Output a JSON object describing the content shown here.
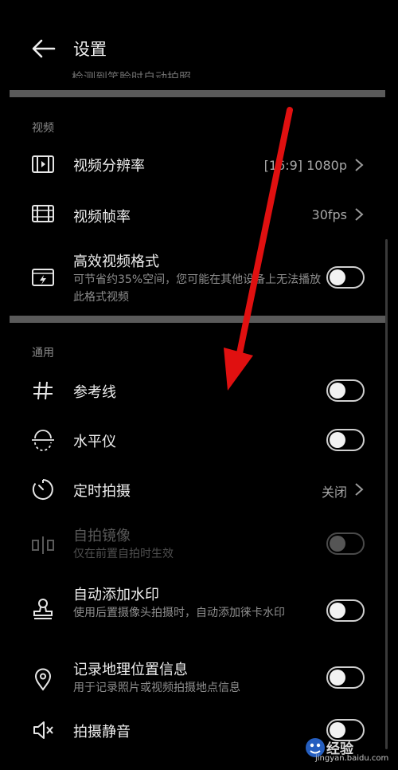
{
  "header": {
    "title": "设置",
    "cut_text": "检测到笑脸时自动拍照"
  },
  "sections": {
    "video": "视频",
    "general": "通用"
  },
  "video": {
    "resolution": {
      "label": "视频分辨率",
      "value": "[16:9] 1080p"
    },
    "framerate": {
      "label": "视频帧率",
      "value": "30fps"
    },
    "efficient_format": {
      "label": "高效视频格式",
      "desc": "可节省约35%空间，您可能在其他设备上无法播放此格式视频",
      "enabled": false
    }
  },
  "general": {
    "gridlines": {
      "label": "参考线",
      "enabled": false
    },
    "level": {
      "label": "水平仪",
      "enabled": false
    },
    "timer": {
      "label": "定时拍摄",
      "value": "关闭"
    },
    "mirror": {
      "label": "自拍镜像",
      "desc": "仅在前置自拍时生效",
      "enabled": false,
      "disabled": true
    },
    "watermark": {
      "label": "自动添加水印",
      "desc": "使用后置摄像头拍摄时，自动添加徕卡水印",
      "enabled": false
    },
    "location": {
      "label": "记录地理位置信息",
      "desc": "用于记录照片或视频拍摄地点信息",
      "enabled": false
    },
    "mute": {
      "label": "拍摄静音",
      "enabled": false
    }
  },
  "watermark_site": {
    "brand": "经验",
    "url": "jingyan.baidu.com"
  },
  "colors": {
    "background": "#000000",
    "arrow": "#e01010",
    "divider": "#5a5a5a"
  }
}
